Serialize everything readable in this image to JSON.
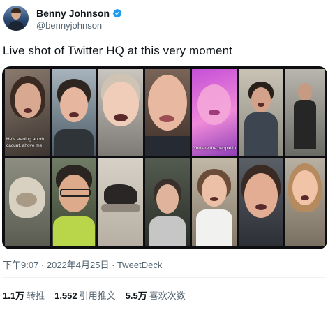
{
  "author": {
    "name": "Benny Johnson",
    "handle": "@bennyjohnson",
    "verified": true
  },
  "tweet": {
    "text": "Live shot of Twitter HQ at this very moment",
    "media": {
      "captions": [
        "He's starting anoth",
        "cacunt, ahove me",
        "You are the people in hi"
      ]
    },
    "timestamp": "下午9:07 · 2022年4月25日 · TweetDeck"
  },
  "stats": {
    "retweets": {
      "value": "1.1万",
      "label": "转推"
    },
    "quotes": {
      "value": "1,552",
      "label": "引用推文"
    },
    "likes": {
      "value": "5.5万",
      "label": "喜欢次数"
    }
  },
  "colors": {
    "verified_badge": "#1d9bf0",
    "secondary_text": "#536471",
    "primary_text": "#0f1419"
  }
}
